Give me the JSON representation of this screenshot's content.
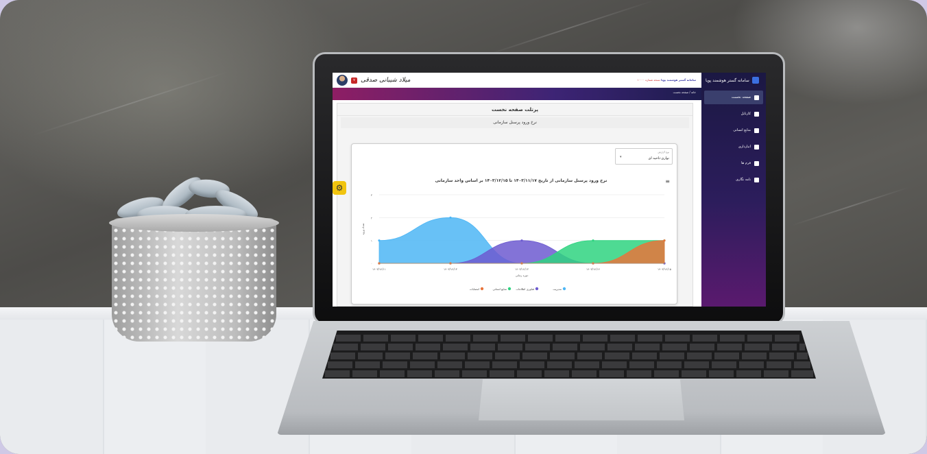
{
  "app": {
    "system_name": "سامانه گستر هوشمند پویا",
    "system_sub": "سامانه گستر هوشمند پویا",
    "system_version": "نسخه شماره ۱۰۰۰۰"
  },
  "sidebar": {
    "items": [
      {
        "label": "صفحه نخست",
        "icon": "home-icon",
        "active": true
      },
      {
        "label": "کارتابل",
        "icon": "briefcase-icon"
      },
      {
        "label": "منابع انسانی",
        "icon": "user-icon"
      },
      {
        "label": "انبارداری",
        "icon": "list-icon"
      },
      {
        "label": "فرم ها",
        "icon": "file-icon"
      },
      {
        "label": "نامه نگاری",
        "icon": "mail-icon"
      }
    ]
  },
  "header": {
    "user_name": "میلاد شیبانی صدقی",
    "notification_count": "۷",
    "breadcrumb": "خانه / صفحه نخست"
  },
  "main": {
    "page_title": "پرتلت صفحه نخست",
    "section_title": "نرخ ورود پرسنل سازمانی",
    "select": {
      "label": "نوع گزارش",
      "value": "نواری-ناحیه ای"
    }
  },
  "colors": {
    "accent": "#1b1843",
    "bar_start": "#8e1e64",
    "bar_end": "#1d1c4d"
  },
  "chart_data": {
    "type": "area",
    "title": "نرخ ورود پرسنل سازمانی از تاریخ ۱۴۰۳/۱۱/۱۷ تا ۱۴۰۳/۱۲/۱۵ بر اساس واحد سازمانی",
    "xlabel": "دوره زمانی",
    "ylabel": "تعداد ورود",
    "categories": [
      "۱۴۰۳/۱۲/۱۱",
      "۱۴۰۳/۱۲/۱۳",
      "۱۴۰۳/۱۲/۱۳",
      "۱۴۰۳/۱۲/۱۴",
      "۱۴۰۳/۱۲/۱۵"
    ],
    "ylim": [
      0,
      3
    ],
    "yticks": [
      "۰",
      "۱",
      "۲",
      "۳"
    ],
    "series": [
      {
        "name": "مدیریت",
        "color": "#4db6f5",
        "values": [
          1,
          2,
          0,
          0,
          0
        ]
      },
      {
        "name": "فناوری اطلاعات",
        "color": "#6d5bd0",
        "values": [
          0,
          0,
          1,
          0,
          0
        ]
      },
      {
        "name": "منابع انسانی",
        "color": "#2fd480",
        "values": [
          0,
          0,
          0,
          1,
          1
        ]
      },
      {
        "name": "انتصابات",
        "color": "#e8743b",
        "values": [
          0,
          0,
          0,
          0,
          1
        ]
      }
    ],
    "legend_position": "bottom"
  }
}
